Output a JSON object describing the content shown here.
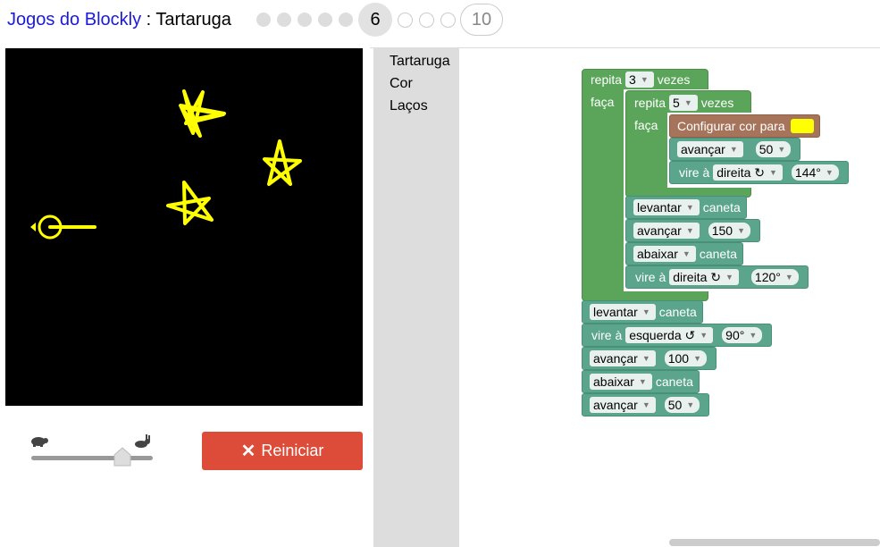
{
  "header": {
    "app_link": "Jogos do Blockly",
    "separator": " : ",
    "game_name": "Tartaruga",
    "current_level": "6",
    "last_level": "10"
  },
  "controls": {
    "reset_label": "Reiniciar",
    "speed_level": 0.75
  },
  "toolbox": {
    "categories": [
      "Tartaruga",
      "Cor",
      "Laços"
    ]
  },
  "blocks": {
    "outer_repeat": {
      "label_repita": "repita",
      "count": "3",
      "label_vezes": "vezes",
      "label_faca": "faça"
    },
    "inner_repeat": {
      "label_repita": "repita",
      "count": "5",
      "label_vezes": "vezes",
      "label_faca": "faça"
    },
    "set_color": {
      "label": "Configurar cor para",
      "color": "#ffff00"
    },
    "move1": {
      "action": "avançar",
      "value": "50"
    },
    "turn1": {
      "label": "vire à",
      "dir": "direita ↻",
      "value": "144°"
    },
    "pen1": {
      "action": "levantar",
      "label": "caneta"
    },
    "move2": {
      "action": "avançar",
      "value": "150"
    },
    "pen2": {
      "action": "abaixar",
      "label": "caneta"
    },
    "turn2": {
      "label": "vire à",
      "dir": "direita ↻",
      "value": "120°"
    },
    "pen3": {
      "action": "levantar",
      "label": "caneta"
    },
    "turn3": {
      "label": "vire à",
      "dir": "esquerda ↺",
      "value": "90°"
    },
    "move3": {
      "action": "avançar",
      "value": "100"
    },
    "pen4": {
      "action": "abaixar",
      "label": "caneta"
    },
    "move4": {
      "action": "avançar",
      "value": "50"
    }
  },
  "colors": {
    "accent_reset": "#dd4b39",
    "loop_green": "#5ba55b",
    "turtle_teal": "#5ba58c",
    "color_brown": "#a5745b",
    "pen": "#ffff00"
  }
}
